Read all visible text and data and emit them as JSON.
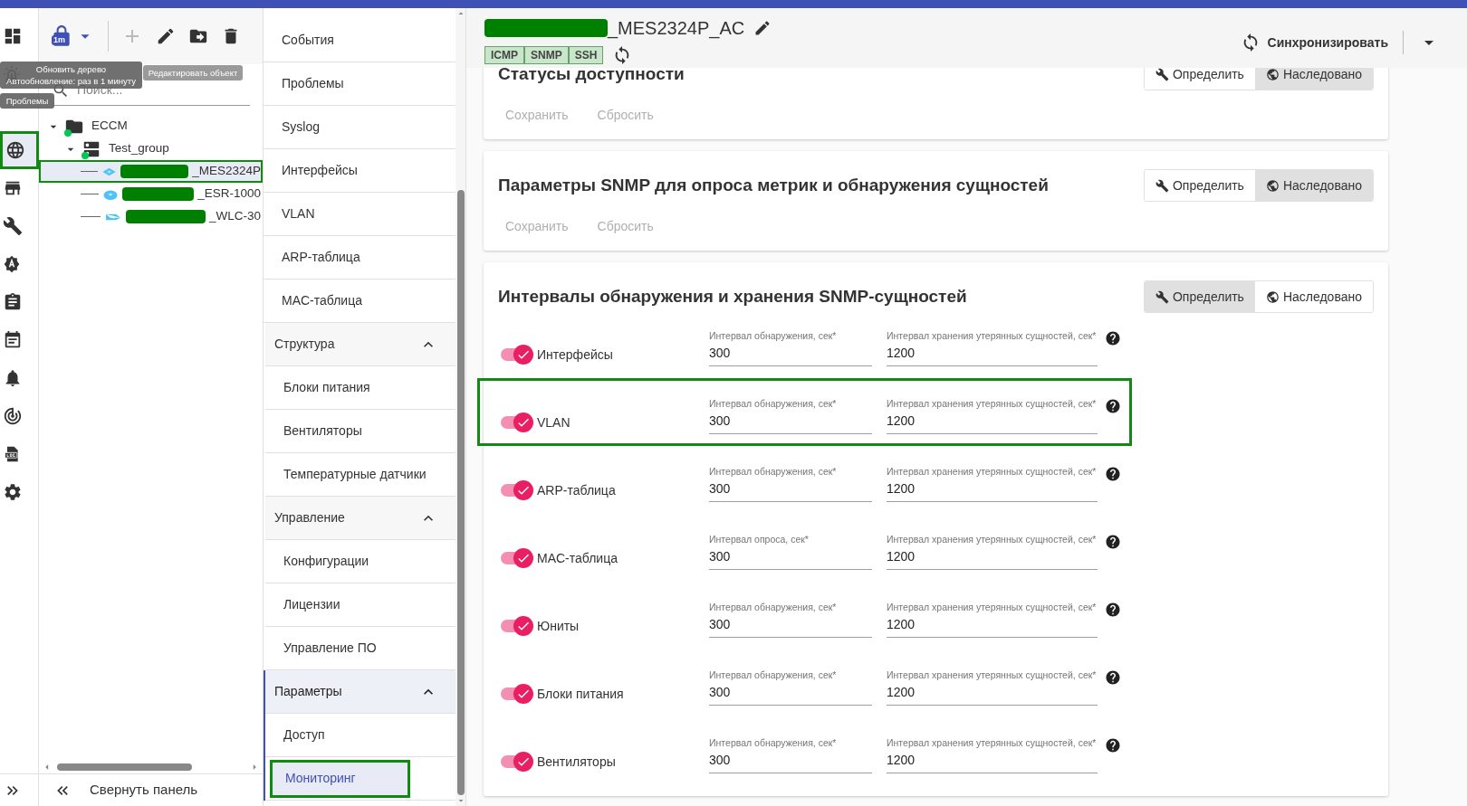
{
  "rail": {
    "items": [
      {
        "selected": false,
        "highlighted": false
      },
      {
        "selected": false,
        "highlighted": false
      },
      {
        "selected": true,
        "highlighted": true
      },
      {
        "selected": false,
        "highlighted": false
      },
      {
        "selected": false,
        "highlighted": false
      },
      {
        "selected": false,
        "highlighted": false
      },
      {
        "selected": false,
        "highlighted": false
      },
      {
        "selected": false,
        "highlighted": false
      },
      {
        "selected": false,
        "highlighted": false
      },
      {
        "selected": false,
        "highlighted": false
      },
      {
        "selected": false,
        "highlighted": false
      },
      {
        "selected": false,
        "highlighted": false
      }
    ]
  },
  "toolbar": {
    "refresh_badge": "1m",
    "add_disabled": true
  },
  "tooltips": [
    {
      "lines": [
        "Обновить дерево",
        "Автообновление: раз в 1 минуту"
      ]
    },
    {
      "lines": [
        "Редактировать объект"
      ]
    },
    {
      "lines": [
        "Проблемы"
      ]
    }
  ],
  "search": {
    "placeholder": "Поиск..."
  },
  "tree": [
    {
      "name": "ECCM",
      "kind": "folder",
      "expanded": true,
      "children": [
        {
          "name": "Test_group",
          "kind": "group",
          "expanded": true,
          "children": [
            {
              "name": "_MES2324P",
              "kind": "switch",
              "redacted": true,
              "selected": true,
              "highlighted": true
            },
            {
              "name": "_ESR-1000",
              "kind": "router",
              "redacted": true,
              "selected": false,
              "highlighted": false
            },
            {
              "name": "_WLC-30",
              "kind": "controller",
              "redacted": true,
              "selected": false,
              "highlighted": false
            }
          ]
        }
      ]
    }
  ],
  "collapse": {
    "label": "Свернуть панель"
  },
  "nav": {
    "items": [
      {
        "label": "События",
        "selected": false,
        "highlighted": false
      },
      {
        "label": "Проблемы",
        "selected": false,
        "highlighted": false
      },
      {
        "label": "Syslog",
        "selected": false,
        "highlighted": false
      },
      {
        "label": "Интерфейсы",
        "selected": false,
        "highlighted": false
      },
      {
        "label": "VLAN",
        "selected": false,
        "highlighted": false
      },
      {
        "label": "ARP-таблица",
        "selected": false,
        "highlighted": false
      },
      {
        "label": "MAC-таблица",
        "selected": false,
        "highlighted": false
      }
    ],
    "sections": [
      {
        "label": "Структура",
        "expanded": true,
        "active": false,
        "items": [
          {
            "label": "Блоки питания",
            "selected": false,
            "highlighted": false
          },
          {
            "label": "Вентиляторы",
            "selected": false,
            "highlighted": false
          },
          {
            "label": "Температурные датчики",
            "selected": false,
            "highlighted": false
          }
        ]
      },
      {
        "label": "Управление",
        "expanded": true,
        "active": false,
        "items": [
          {
            "label": "Конфигурации",
            "selected": false,
            "highlighted": false
          },
          {
            "label": "Лицензии",
            "selected": false,
            "highlighted": false
          },
          {
            "label": "Управление ПО",
            "selected": false,
            "highlighted": false
          }
        ]
      },
      {
        "label": "Параметры",
        "expanded": true,
        "active": true,
        "items": [
          {
            "label": "Доступ",
            "selected": false,
            "highlighted": false
          },
          {
            "label": "Мониторинг",
            "selected": true,
            "highlighted": true
          }
        ]
      }
    ]
  },
  "device": {
    "title": "_MES2324P_AC",
    "redacted": true,
    "tags": [
      "ICMP",
      "SNMP",
      "SSH"
    ]
  },
  "sync_button": {
    "label": "Синхронизировать"
  },
  "cards": [
    {
      "title": "Статусы доступности",
      "modes": [
        {
          "label": "Определить",
          "selected": false
        },
        {
          "label": "Наследовано",
          "selected": true
        }
      ],
      "actions": [
        "Сохранить",
        "Сбросить"
      ]
    },
    {
      "title": "Параметры SNMP для опроса метрик и обнаружения сущностей",
      "modes": [
        {
          "label": "Определить",
          "selected": false
        },
        {
          "label": "Наследовано",
          "selected": true
        }
      ],
      "actions": [
        "Сохранить",
        "Сбросить"
      ]
    },
    {
      "title": "Интервалы обнаружения и хранения SNMP-сущностей",
      "modes": [
        {
          "label": "Определить",
          "selected": true
        },
        {
          "label": "Наследовано",
          "selected": false
        }
      ],
      "rows": [
        {
          "label": "Интерфейсы",
          "on": true,
          "highlighted": false,
          "fields": [
            {
              "label": "Интервал обнаружения, сек*",
              "value": "300"
            },
            {
              "label": "Интервал хранения утерянных сущностей, сек*",
              "value": "1200"
            }
          ]
        },
        {
          "label": "VLAN",
          "on": true,
          "highlighted": true,
          "fields": [
            {
              "label": "Интервал обнаружения, сек*",
              "value": "300"
            },
            {
              "label": "Интервал хранения утерянных сущностей, сек*",
              "value": "1200"
            }
          ]
        },
        {
          "label": "ARP-таблица",
          "on": true,
          "highlighted": false,
          "fields": [
            {
              "label": "Интервал обнаружения, сек*",
              "value": "300"
            },
            {
              "label": "Интервал хранения утерянных сущностей, сек*",
              "value": "1200"
            }
          ]
        },
        {
          "label": "MAC-таблица",
          "on": true,
          "highlighted": false,
          "fields": [
            {
              "label": "Интервал опроса, сек*",
              "value": "300"
            },
            {
              "label": "Интервал хранения утерянных сущностей, сек*",
              "value": "1200"
            }
          ]
        },
        {
          "label": "Юниты",
          "on": true,
          "highlighted": false,
          "fields": [
            {
              "label": "Интервал обнаружения, сек*",
              "value": "300"
            },
            {
              "label": "Интервал хранения утерянных сущностей, сек*",
              "value": "1200"
            }
          ]
        },
        {
          "label": "Блоки питания",
          "on": true,
          "highlighted": false,
          "fields": [
            {
              "label": "Интервал обнаружения, сек*",
              "value": "300"
            },
            {
              "label": "Интервал хранения утерянных сущностей, сек*",
              "value": "1200"
            }
          ]
        },
        {
          "label": "Вентиляторы",
          "on": true,
          "highlighted": false,
          "fields": [
            {
              "label": "Интервал обнаружения, сек*",
              "value": "300"
            },
            {
              "label": "Интервал хранения утерянных сущностей, сек*",
              "value": "1200"
            }
          ]
        }
      ]
    }
  ]
}
